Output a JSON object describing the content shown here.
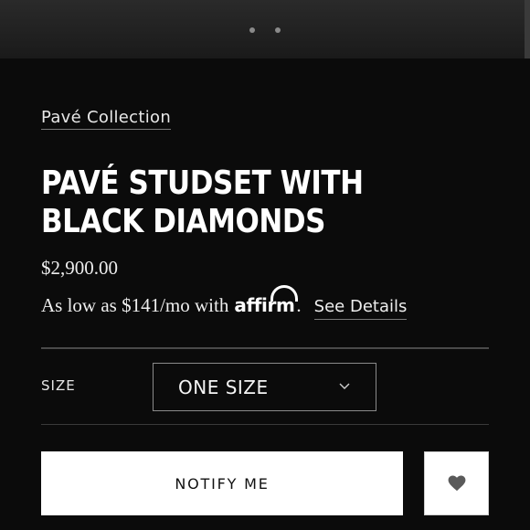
{
  "carousel": {
    "dot_count": 2
  },
  "product": {
    "collection_link": "Pavé Collection",
    "title": "PAVÉ STUDSET WITH BLACK DIAMONDS",
    "price": "$2,900.00"
  },
  "financing": {
    "prefix": "As low as $141/mo with",
    "brand": "affirm",
    "suffix": ".",
    "details_link": "See Details"
  },
  "options": {
    "size_label": "SIZE",
    "size_selected": "ONE SIZE"
  },
  "actions": {
    "notify_label": "NOTIFY ME",
    "wishlist_icon": "heart-icon"
  }
}
